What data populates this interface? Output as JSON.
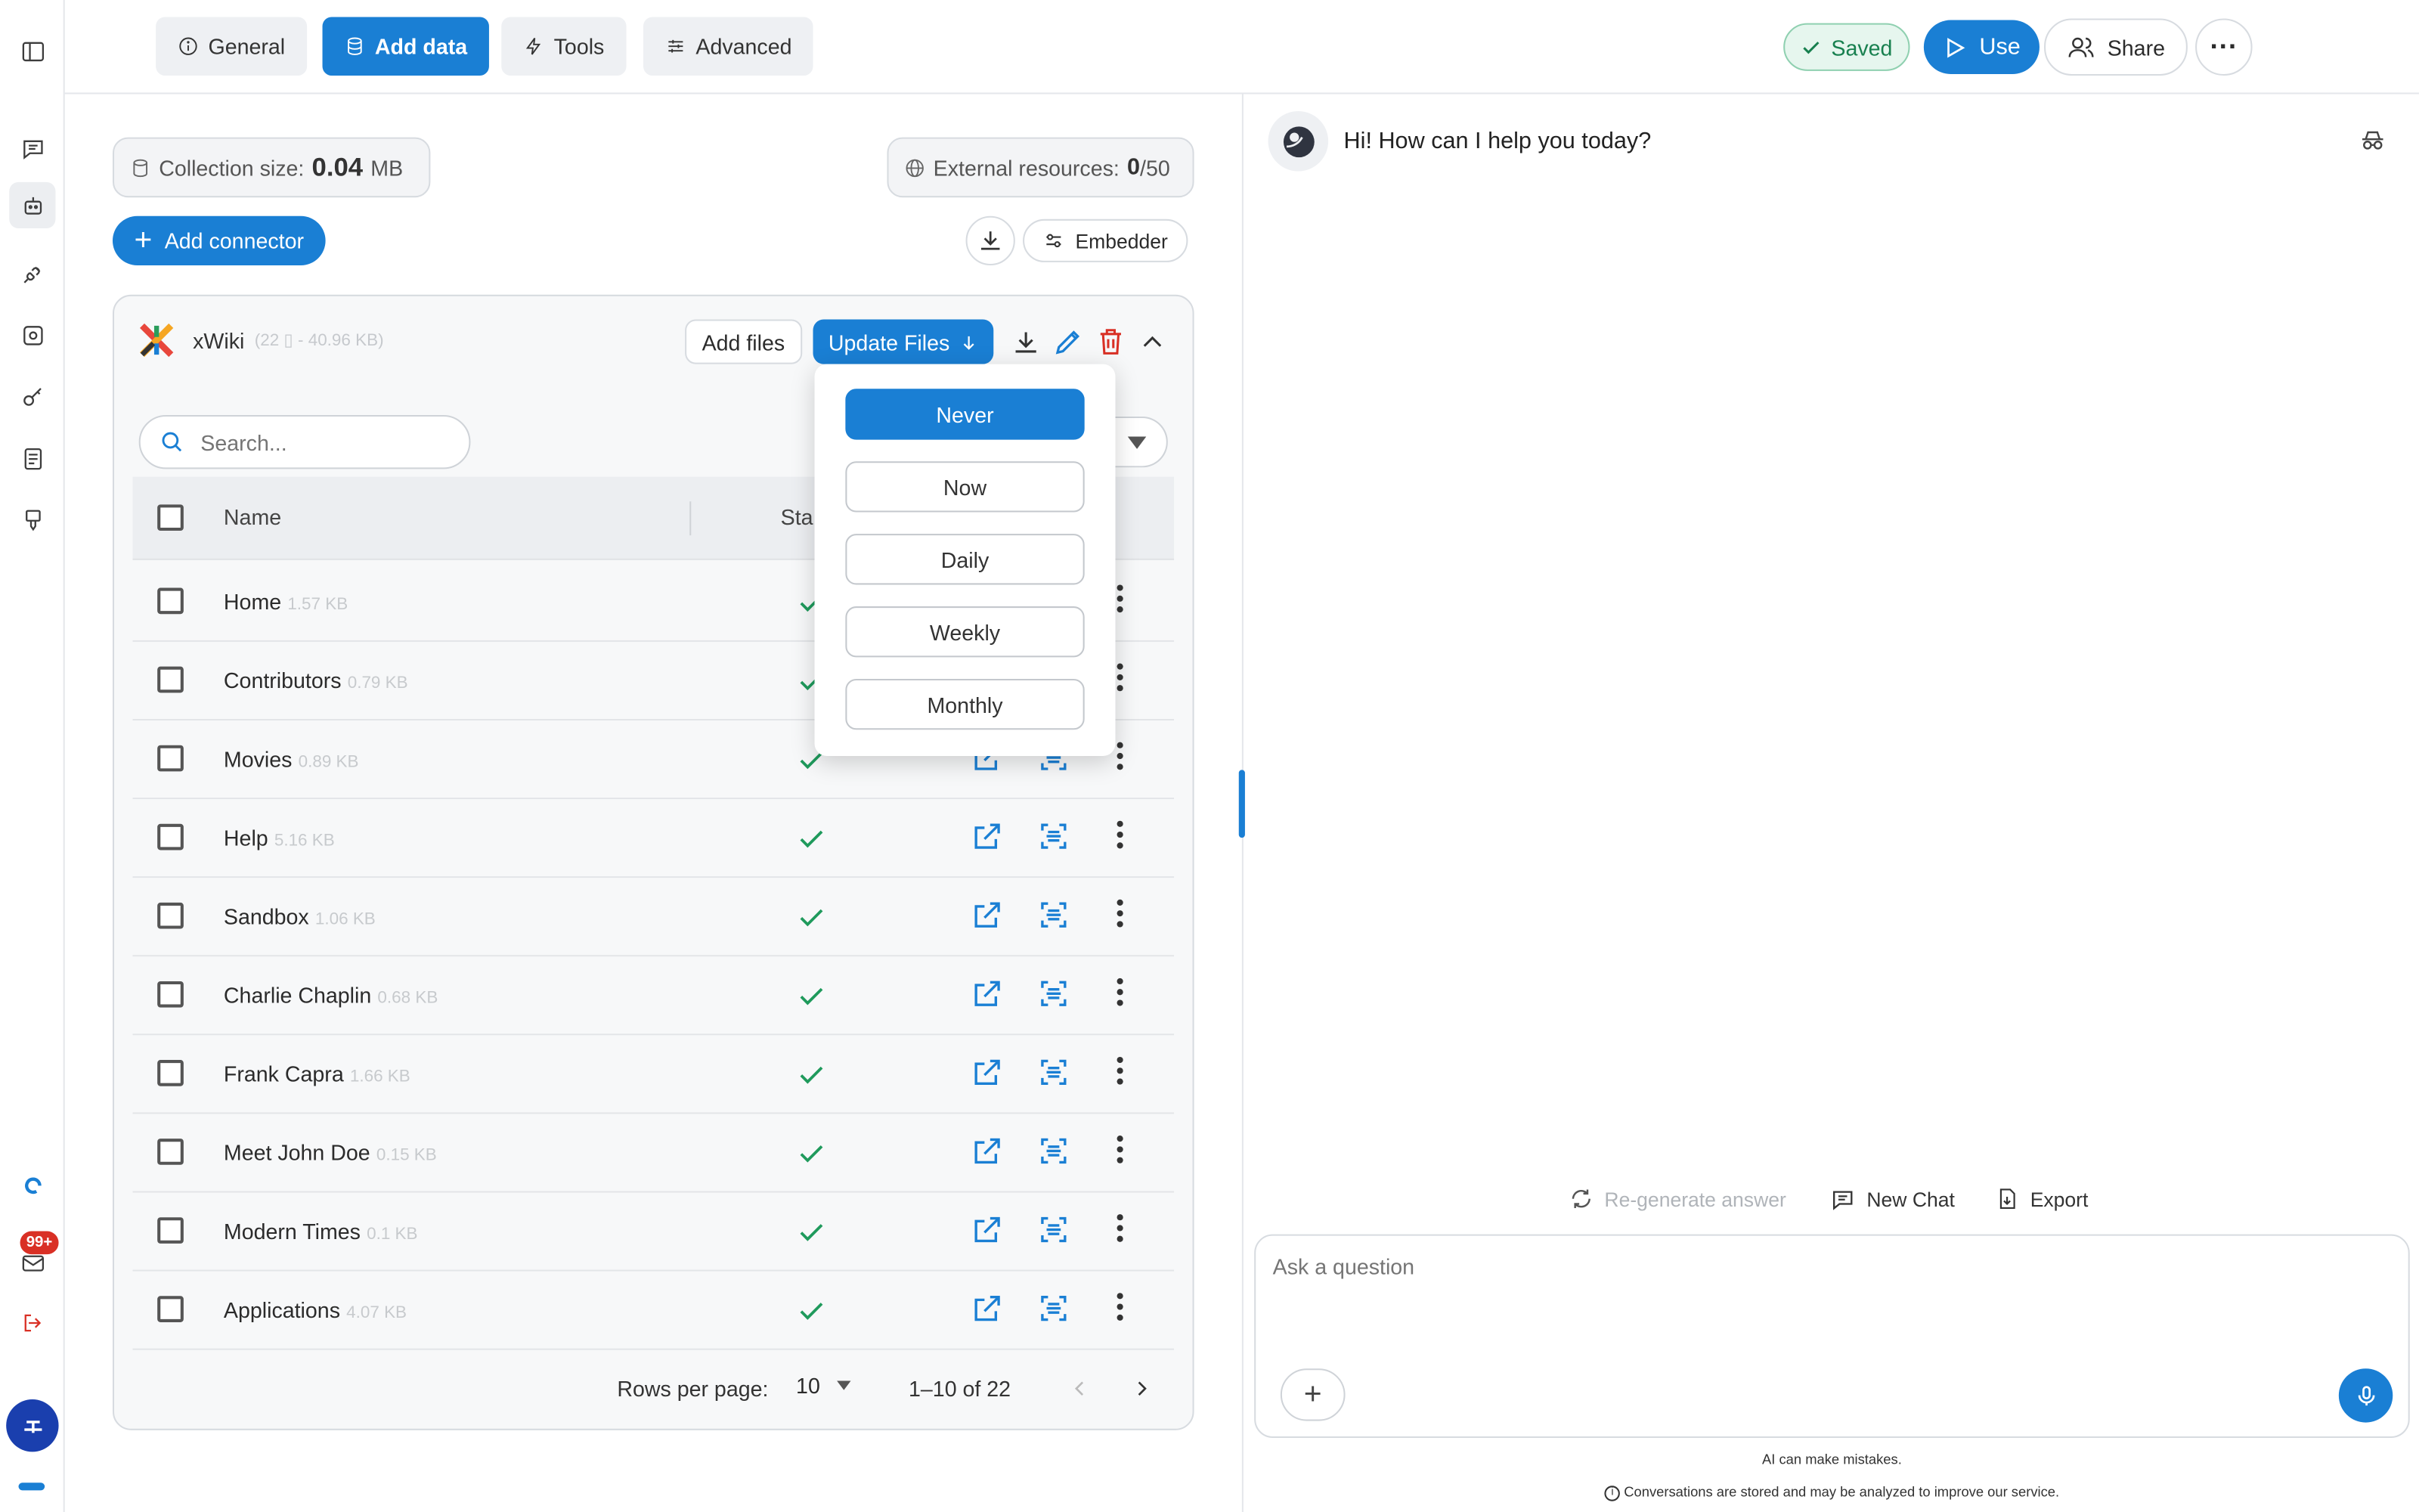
{
  "tabs": [
    {
      "label": "General",
      "icon": "info-icon"
    },
    {
      "label": "Add data",
      "icon": "database-icon"
    },
    {
      "label": "Tools",
      "icon": "bolt-icon"
    },
    {
      "label": "Advanced",
      "icon": "sliders-icon"
    }
  ],
  "header": {
    "saved": "Saved",
    "use": "Use",
    "share": "Share"
  },
  "collection": {
    "label": "Collection size:",
    "value": "0.04",
    "unit": "MB"
  },
  "external": {
    "label": "External resources:",
    "value": "0",
    "max": "/50"
  },
  "add_connector": "Add connector",
  "embedder": "Embedder",
  "connector": {
    "name": "xWiki",
    "meta": "(22 ▯ - 40.96 KB)",
    "add_files": "Add files",
    "update_files": "Update Files"
  },
  "search_placeholder": "Search...",
  "table": {
    "col_name": "Name",
    "col_status": "Sta",
    "rows": [
      {
        "name": "Home",
        "size": "1.57 KB"
      },
      {
        "name": "Contributors",
        "size": "0.79 KB"
      },
      {
        "name": "Movies",
        "size": "0.89 KB"
      },
      {
        "name": "Help",
        "size": "5.16 KB"
      },
      {
        "name": "Sandbox",
        "size": "1.06 KB"
      },
      {
        "name": "Charlie Chaplin",
        "size": "0.68 KB"
      },
      {
        "name": "Frank Capra",
        "size": "1.66 KB"
      },
      {
        "name": "Meet John Doe",
        "size": "0.15 KB"
      },
      {
        "name": "Modern Times",
        "size": "0.1 KB"
      },
      {
        "name": "Applications",
        "size": "4.07 KB"
      }
    ]
  },
  "pagination": {
    "rows_label": "Rows per page:",
    "rows_value": "10",
    "range": "1–10 of 22"
  },
  "dropdown": [
    "Never",
    "Now",
    "Daily",
    "Weekly",
    "Monthly"
  ],
  "chat": {
    "greeting": "Hi! How can I help you today?",
    "regenerate": "Re-generate answer",
    "new_chat": "New Chat",
    "export": "Export",
    "placeholder": "Ask a question",
    "disclaimer": "AI can make mistakes.",
    "privacy": "Conversations are stored and may be analyzed to improve our service."
  },
  "notifications_badge": "99+",
  "colors": {
    "accent": "#1a7fd4",
    "success": "#18804f",
    "danger": "#d93025"
  }
}
